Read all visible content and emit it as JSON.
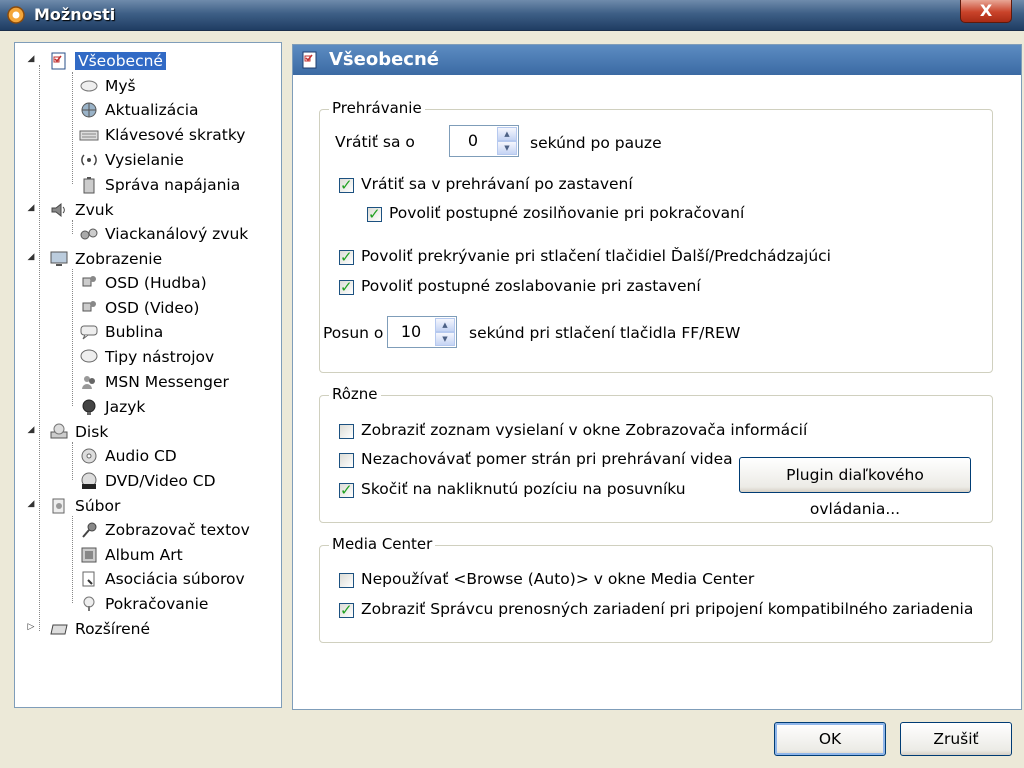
{
  "window": {
    "title": "Možnosti",
    "close_label": "X"
  },
  "tree": {
    "root_items": [
      {
        "label": "Všeobecné",
        "selected": true
      },
      {
        "label": "Zvuk"
      },
      {
        "label": "Zobrazenie"
      },
      {
        "label": "Disk"
      },
      {
        "label": "Súbor"
      },
      {
        "label": "Rozšírené"
      }
    ],
    "vseobecne_children": [
      "Myš",
      "Aktualizácia",
      "Klávesové skratky",
      "Vysielanie",
      "Správa napájania"
    ],
    "zvuk_children": [
      "Viackanálový zvuk"
    ],
    "zobrazenie_children": [
      "OSD (Hudba)",
      "OSD (Video)",
      "Bublina",
      "Tipy nástrojov",
      "MSN Messenger",
      "Jazyk"
    ],
    "disk_children": [
      "Audio CD",
      "DVD/Video CD"
    ],
    "subor_children": [
      "Zobrazovač textov",
      "Album Art",
      "Asociácia súborov",
      "Pokračovanie"
    ]
  },
  "panel": {
    "title": "Všeobecné",
    "playback": {
      "title": "Prehrávanie",
      "rewind_label": "Vrátiť sa o",
      "rewind_value": "0",
      "rewind_suffix": "sekúnd po pauze",
      "opt_return_after_stop": "Vrátiť sa v prehrávaní po zastavení",
      "opt_fade_in_resume": "Povoliť postupné zosilňovanie pri pokračovaní",
      "opt_crossfade_next_prev": "Povoliť prekrývanie pri stlačení tlačidiel Ďalší/Predchádzajúci",
      "opt_fade_out_stop": "Povoliť postupné zoslabovanie pri zastavení",
      "shift_label": "Posun o",
      "shift_value": "10",
      "shift_suffix": "sekúnd pri stlačení tlačidla FF/REW"
    },
    "misc": {
      "title": "Rôzne",
      "opt_show_broadcast_list": "Zobraziť zoznam vysielaní v okne Zobrazovača informácií",
      "opt_no_aspect_ratio": "Nezachovávať pomer strán pri prehrávaní videa",
      "opt_jump_to_click": "Skočiť na nakliknutú pozíciu na posuvníku",
      "plugin_button": "Plugin diaľkového ovládania..."
    },
    "media_center": {
      "title": "Media Center",
      "opt_no_browse_auto": "Nepoužívať <Browse (Auto)> v okne Media Center",
      "opt_show_device_manager": "Zobraziť Správcu prenosných zariadení pri pripojení kompatibilného zariadenia"
    }
  },
  "buttons": {
    "ok": "OK",
    "cancel": "Zrušiť"
  },
  "colors": {
    "titlebar": "#3e5f86",
    "panel_header": "#4a7bb5",
    "selection": "#316ac5",
    "check": "#21a121"
  }
}
